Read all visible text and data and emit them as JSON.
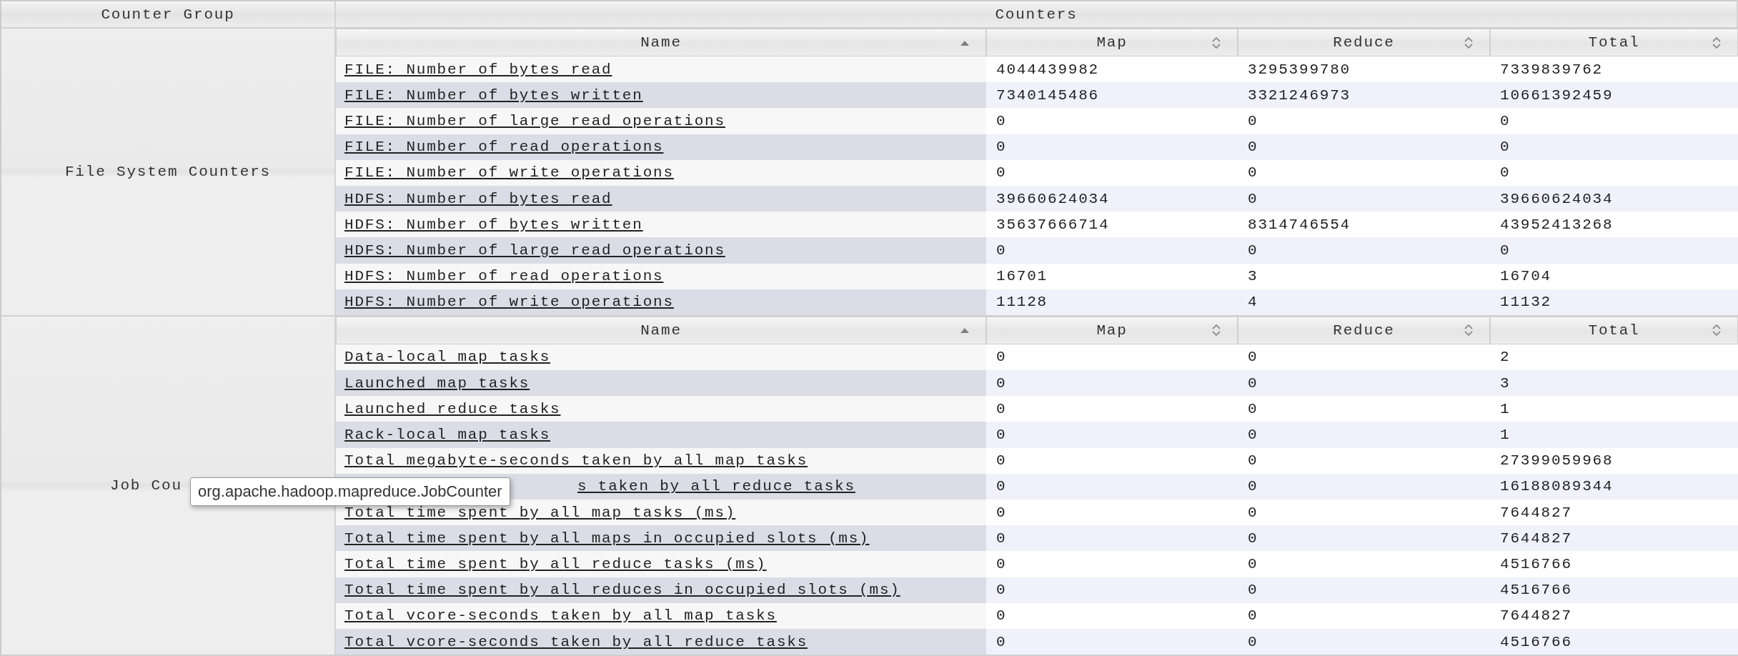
{
  "table": {
    "columns": [
      "Counter Group",
      "Counters"
    ],
    "groups": [
      {
        "name": "File System Counters",
        "kind": "normal",
        "columns": [
          {
            "label": "Name",
            "sorted": true
          },
          {
            "label": "Map",
            "sorted": false
          },
          {
            "label": "Reduce",
            "sorted": false
          },
          {
            "label": "Total",
            "sorted": false
          }
        ],
        "rows": [
          {
            "kind": "normal",
            "name": "FILE: Number of bytes read",
            "map": "4044439982",
            "reduce": "3295399780",
            "total": "7339839762"
          },
          {
            "kind": "normal",
            "name": "FILE: Number of bytes written",
            "map": "7340145486",
            "reduce": "3321246973",
            "total": "10661392459"
          },
          {
            "kind": "normal",
            "name": "FILE: Number of large read operations",
            "map": "0",
            "reduce": "0",
            "total": "0"
          },
          {
            "kind": "normal",
            "name": "FILE: Number of read operations",
            "map": "0",
            "reduce": "0",
            "total": "0"
          },
          {
            "kind": "normal",
            "name": "FILE: Number of write operations",
            "map": "0",
            "reduce": "0",
            "total": "0"
          },
          {
            "kind": "normal",
            "name": "HDFS: Number of bytes read",
            "map": "39660624034",
            "reduce": "0",
            "total": "39660624034"
          },
          {
            "kind": "normal",
            "name": "HDFS: Number of bytes written",
            "map": "35637666714",
            "reduce": "8314746554",
            "total": "43952413268"
          },
          {
            "kind": "normal",
            "name": "HDFS: Number of large read operations",
            "map": "0",
            "reduce": "0",
            "total": "0"
          },
          {
            "kind": "normal",
            "name": "HDFS: Number of read operations",
            "map": "16701",
            "reduce": "3",
            "total": "16704"
          },
          {
            "kind": "normal",
            "name": "HDFS: Number of write operations",
            "map": "11128",
            "reduce": "4",
            "total": "11132"
          }
        ]
      },
      {
        "name": "Job Cou",
        "kind": "clipped",
        "tooltip": "org.apache.hadoop.mapreduce.JobCounter",
        "columns": [
          {
            "label": "Name",
            "sorted": true
          },
          {
            "label": "Map",
            "sorted": false
          },
          {
            "label": "Reduce",
            "sorted": false
          },
          {
            "label": "Total",
            "sorted": false
          }
        ],
        "rows": [
          {
            "kind": "normal",
            "name": "Data-local map tasks",
            "map": "0",
            "reduce": "0",
            "total": "2"
          },
          {
            "kind": "normal",
            "name": "Launched map tasks",
            "map": "0",
            "reduce": "0",
            "total": "3"
          },
          {
            "kind": "normal",
            "name": "Launched reduce tasks",
            "map": "0",
            "reduce": "0",
            "total": "1"
          },
          {
            "kind": "normal",
            "name": "Rack-local map tasks",
            "map": "0",
            "reduce": "0",
            "total": "1"
          },
          {
            "kind": "normal",
            "name": "Total megabyte-seconds taken by all map tasks",
            "map": "0",
            "reduce": "0",
            "total": "27399059968"
          },
          {
            "kind": "clipped",
            "name": "s taken by all reduce tasks",
            "map": "0",
            "reduce": "0",
            "total": "16188089344"
          },
          {
            "kind": "normal",
            "name": "Total time spent by all map tasks (ms)",
            "map": "0",
            "reduce": "0",
            "total": "7644827"
          },
          {
            "kind": "normal",
            "name": "Total time spent by all maps in occupied slots (ms)",
            "map": "0",
            "reduce": "0",
            "total": "7644827"
          },
          {
            "kind": "normal",
            "name": "Total time spent by all reduce tasks (ms)",
            "map": "0",
            "reduce": "0",
            "total": "4516766"
          },
          {
            "kind": "normal",
            "name": "Total time spent by all reduces in occupied slots (ms)",
            "map": "0",
            "reduce": "0",
            "total": "4516766"
          },
          {
            "kind": "normal",
            "name": "Total vcore-seconds taken by all map tasks",
            "map": "0",
            "reduce": "0",
            "total": "7644827"
          },
          {
            "kind": "normal",
            "name": "Total vcore-seconds taken by all reduce tasks",
            "map": "0",
            "reduce": "0",
            "total": "4516766"
          }
        ]
      }
    ]
  }
}
